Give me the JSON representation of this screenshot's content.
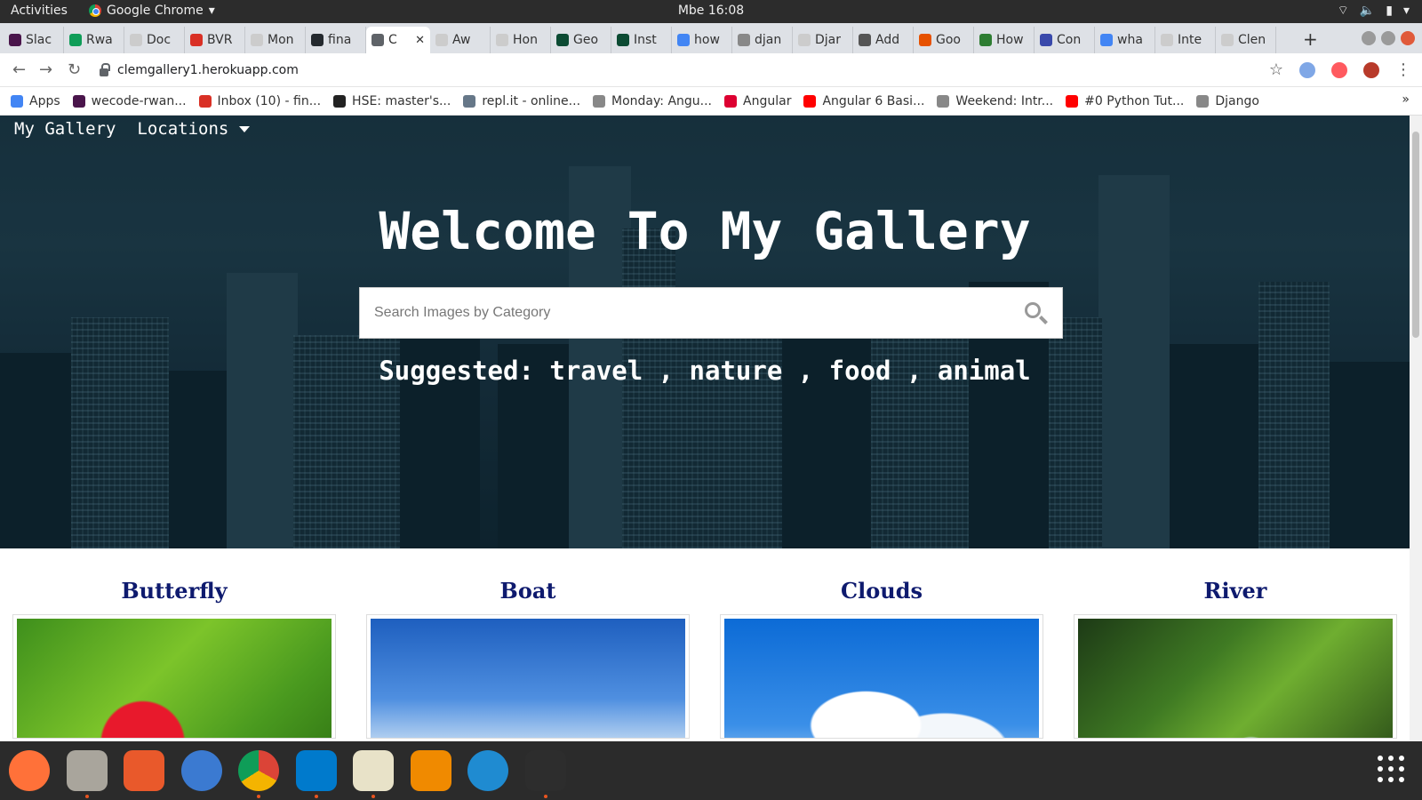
{
  "system": {
    "activities": "Activities",
    "app_name": "Google Chrome",
    "clock": "Mbe 16:08"
  },
  "tabs": [
    {
      "label": "Slac",
      "color": "#4a154b"
    },
    {
      "label": "Rwa",
      "color": "#0f9d58"
    },
    {
      "label": "Doc",
      "color": "#cccccc"
    },
    {
      "label": "BVR",
      "color": "#d93025"
    },
    {
      "label": "Mon",
      "color": "#cccccc"
    },
    {
      "label": "fina",
      "color": "#24292e"
    },
    {
      "label": "C",
      "color": "#5f6368",
      "active": true
    },
    {
      "label": "Aw",
      "color": "#cccccc"
    },
    {
      "label": "Hon",
      "color": "#cccccc"
    },
    {
      "label": "Geo",
      "color": "#0c4b33"
    },
    {
      "label": "Inst",
      "color": "#0c4b33"
    },
    {
      "label": "how",
      "color": "#4285f4"
    },
    {
      "label": "djan",
      "color": "#888888"
    },
    {
      "label": "Djar",
      "color": "#cccccc"
    },
    {
      "label": "Add",
      "color": "#555555"
    },
    {
      "label": "Goo",
      "color": "#e65100"
    },
    {
      "label": "How",
      "color": "#2e7d32"
    },
    {
      "label": "Con",
      "color": "#3949ab"
    },
    {
      "label": "wha",
      "color": "#4285f4"
    },
    {
      "label": "Inte",
      "color": "#cccccc"
    },
    {
      "label": "Clen",
      "color": "#cccccc"
    }
  ],
  "browser": {
    "url": "clemgallery1.herokuapp.com"
  },
  "bookmarks": [
    {
      "label": "Apps",
      "color": "#4285f4"
    },
    {
      "label": "wecode-rwan...",
      "color": "#4a154b"
    },
    {
      "label": "Inbox (10) - fin...",
      "color": "#d93025"
    },
    {
      "label": "HSE: master's...",
      "color": "#222222"
    },
    {
      "label": "repl.it - online...",
      "color": "#667788"
    },
    {
      "label": "Monday: Angu...",
      "color": "#888888"
    },
    {
      "label": "Angular",
      "color": "#dd0031"
    },
    {
      "label": "Angular 6 Basi...",
      "color": "#ff0000"
    },
    {
      "label": "Weekend: Intr...",
      "color": "#888888"
    },
    {
      "label": "#0 Python Tut...",
      "color": "#ff0000"
    },
    {
      "label": "Django",
      "color": "#888888"
    }
  ],
  "bookmarks_more": "»",
  "page": {
    "nav": {
      "brand": "My Gallery",
      "locations": "Locations"
    },
    "title": "Welcome To My Gallery",
    "search": {
      "placeholder": "Search Images by Category"
    },
    "suggested": "Suggested: travel , nature , food , animal"
  },
  "gallery": [
    {
      "title": "Butterfly",
      "image": "butterfly"
    },
    {
      "title": "Boat",
      "image": "boat"
    },
    {
      "title": "Clouds",
      "image": "clouds"
    },
    {
      "title": "River",
      "image": "river"
    }
  ],
  "dock": [
    {
      "name": "firefox-icon",
      "color": "#ff7139",
      "running": false
    },
    {
      "name": "files-icon",
      "color": "#a9a59c",
      "running": true
    },
    {
      "name": "software-center-icon",
      "color": "#e9592b",
      "running": false
    },
    {
      "name": "help-icon",
      "color": "#3b7ad1",
      "running": false
    },
    {
      "name": "chrome-icon",
      "color": "#4285f4",
      "running": true
    },
    {
      "name": "vscode-icon",
      "color": "#007acc",
      "running": true
    },
    {
      "name": "text-editor-icon",
      "color": "#e8e2c8",
      "running": true
    },
    {
      "name": "vlc-icon",
      "color": "#f08a00",
      "running": false
    },
    {
      "name": "globe-app-icon",
      "color": "#1f8bd1",
      "running": false
    },
    {
      "name": "terminal-icon",
      "color": "#2d2d2d",
      "running": true
    }
  ]
}
